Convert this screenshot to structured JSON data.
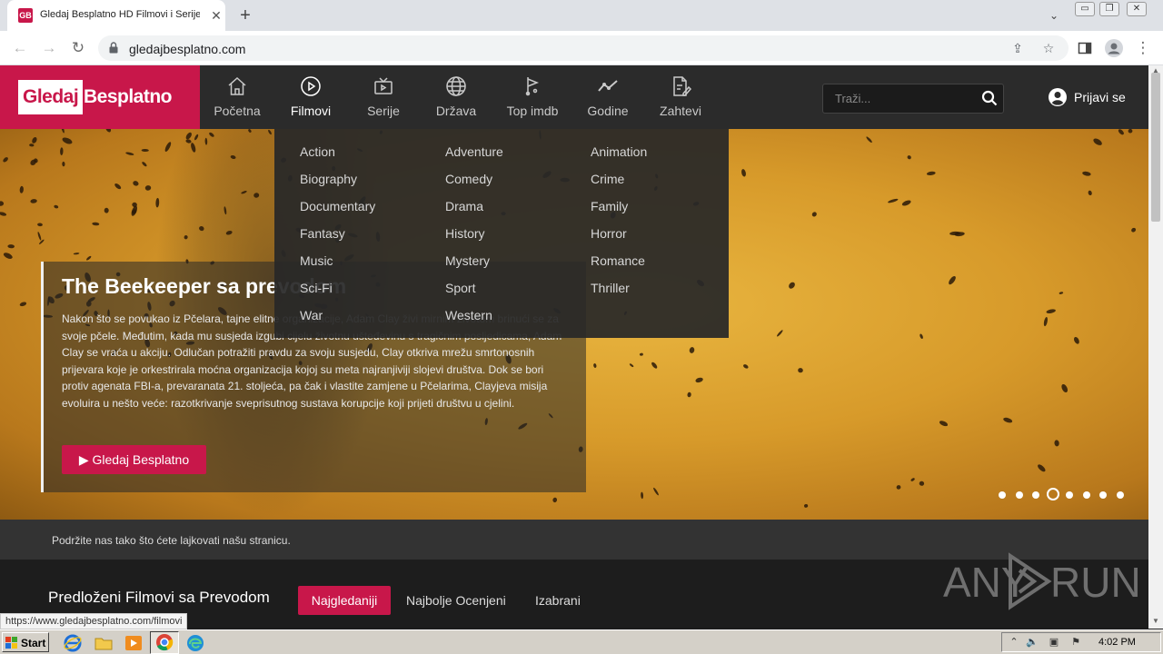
{
  "browser": {
    "tab_title": "Gledaj Besplatno HD Filmovi i Serije s",
    "favicon_text": "GB",
    "url": "gledajbesplatno.com",
    "status_url": "https://www.gledajbesplatno.com/filmovi"
  },
  "site": {
    "logo_part1": "Gledaj",
    "logo_part2": "Besplatno",
    "brand_color": "#c8174a",
    "nav": [
      {
        "label": "Početna",
        "icon": "home-icon"
      },
      {
        "label": "Filmovi",
        "icon": "play-circle-icon",
        "active": true
      },
      {
        "label": "Serije",
        "icon": "tv-icon"
      },
      {
        "label": "Država",
        "icon": "globe-icon"
      },
      {
        "label": "Top imdb",
        "icon": "flag-route-icon"
      },
      {
        "label": "Godine",
        "icon": "trend-line-icon"
      },
      {
        "label": "Zahtevi",
        "icon": "edit-document-icon"
      }
    ],
    "search_placeholder": "Traži...",
    "login_label": "Prijavi se"
  },
  "dropdown": {
    "genres": [
      "Action",
      "Adventure",
      "Animation",
      "Biography",
      "Comedy",
      "Crime",
      "Documentary",
      "Drama",
      "Family",
      "Fantasy",
      "History",
      "Horror",
      "Music",
      "Mystery",
      "Romance",
      "Sci-Fi",
      "Sport",
      "Thriller",
      "War",
      "Western"
    ]
  },
  "hero": {
    "title": "The Beekeeper sa prevodom",
    "description": "Nakon što se povukao iz Pčelara, tajne elitne organizacije, Adam Clay živi mirnim životom brinući se za svoje pčele. Međutim, kada mu susjeda izgubi cijelu životnu ušteđevinu s tragičnim posljedicama, Adam Clay se vraća u akciju. Odlučan potražiti pravdu za svoju susjedu, Clay otkriva mrežu smrtonosnih prijevara koje je orkestrirala moćna organizacija kojoj su meta najranjiviji slojevi društva. Dok se bori protiv agenata FBI-a, prevaranata 21. stoljeća, pa čak i vlastite zamjene u Pčelarima, Clayjeva misija evoluira u nešto veće: razotkrivanje sveprisutnog sustava korupcije koji prijeti društvu u cjelini.",
    "button_label": "▶ Gledaj Besplatno",
    "slides_count": 8,
    "active_slide": 4
  },
  "support_text": "Podržite nas tako što ćete lajkovati našu stranicu.",
  "suggested": {
    "title": "Predloženi Filmovi sa Prevodom",
    "tabs": [
      "Najgledaniji",
      "Najbolje Ocenjeni",
      "Izabrani"
    ]
  },
  "watermark": {
    "part1": "ANY",
    "part2": "RUN"
  },
  "taskbar": {
    "start_label": "Start",
    "clock": "4:02 PM"
  }
}
